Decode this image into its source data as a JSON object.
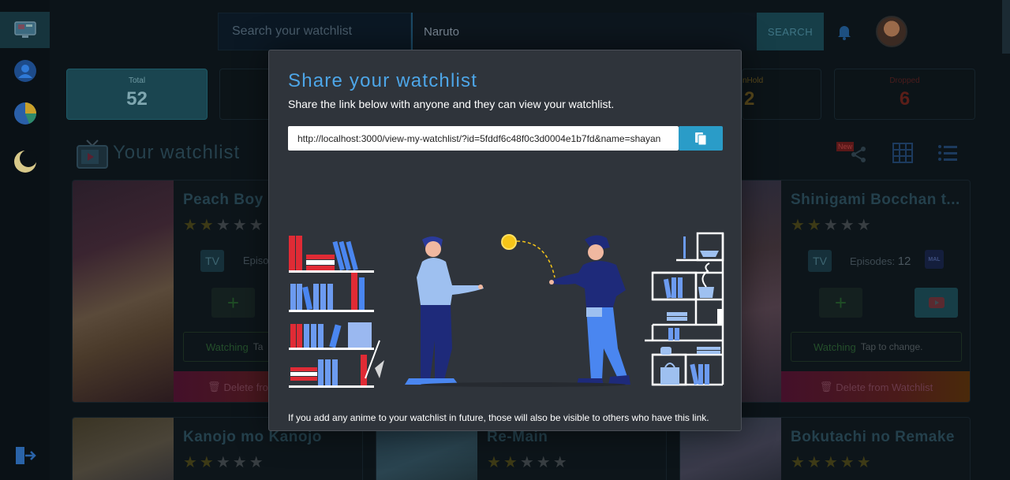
{
  "sidebar": {
    "items": [
      {
        "icon": "monitor-icon",
        "active": true
      },
      {
        "icon": "user-icon",
        "active": false
      },
      {
        "icon": "pie-chart-icon",
        "active": false
      },
      {
        "icon": "moon-icon",
        "active": false
      }
    ],
    "bottom_icon": "logout-icon"
  },
  "header": {
    "search_dropdown_label": "Search your watchlist",
    "search_value": "Naruto",
    "search_button": "SEARCH",
    "bell_icon": "bell-icon",
    "avatar_icon": "avatar"
  },
  "stats": [
    {
      "label": "Total",
      "value": "52"
    },
    {
      "label": "",
      "value": ""
    },
    {
      "label": "nHold",
      "value": "2"
    },
    {
      "label": "Dropped",
      "value": "6"
    }
  ],
  "section": {
    "title": "Your watchlist",
    "new_badge": "New"
  },
  "cards": [
    {
      "title": "Peach Boy R",
      "stars": 2,
      "badge": "TV",
      "episodes_label": "Episod",
      "episodes_value": "",
      "status": "Watching",
      "status_hint": "Ta",
      "delete": "Delete fro"
    },
    {
      "title": "Shinigami Bocchan t...",
      "stars": 2,
      "badge": "TV",
      "episodes_label": "Episodes:",
      "episodes_value": "12",
      "mal": "MAL",
      "status": "Watching",
      "status_hint": "Tap to change.",
      "delete": "Delete from Watchlist"
    },
    {
      "title": "Kanojo mo Kanojo",
      "stars": 2
    },
    {
      "title": "Re-Main",
      "stars": 2
    },
    {
      "title": "Bokutachi no Remake",
      "stars": 5
    }
  ],
  "modal": {
    "title": "Share your watchlist",
    "subtitle": "Share the link below with anyone and they can view your watchlist.",
    "link": "http://localhost:3000/view-my-watchlist/?id=5fddf6c48f0c3d0004e1b7fd&name=shayan",
    "copy_icon": "copy-icon",
    "footer": "If you add any anime to your watchlist in future, those will also be visible to others who have this link."
  },
  "colors": {
    "accent": "#4da6e8",
    "copy_button": "#2a9cc8",
    "modal_bg": "#2f343b",
    "page_bg": "#0c1419",
    "danger": "#e0246a",
    "bookshelf_red": "#e02b35",
    "bookshelf_blue": "#4a86f0",
    "coin": "#f5c518"
  }
}
